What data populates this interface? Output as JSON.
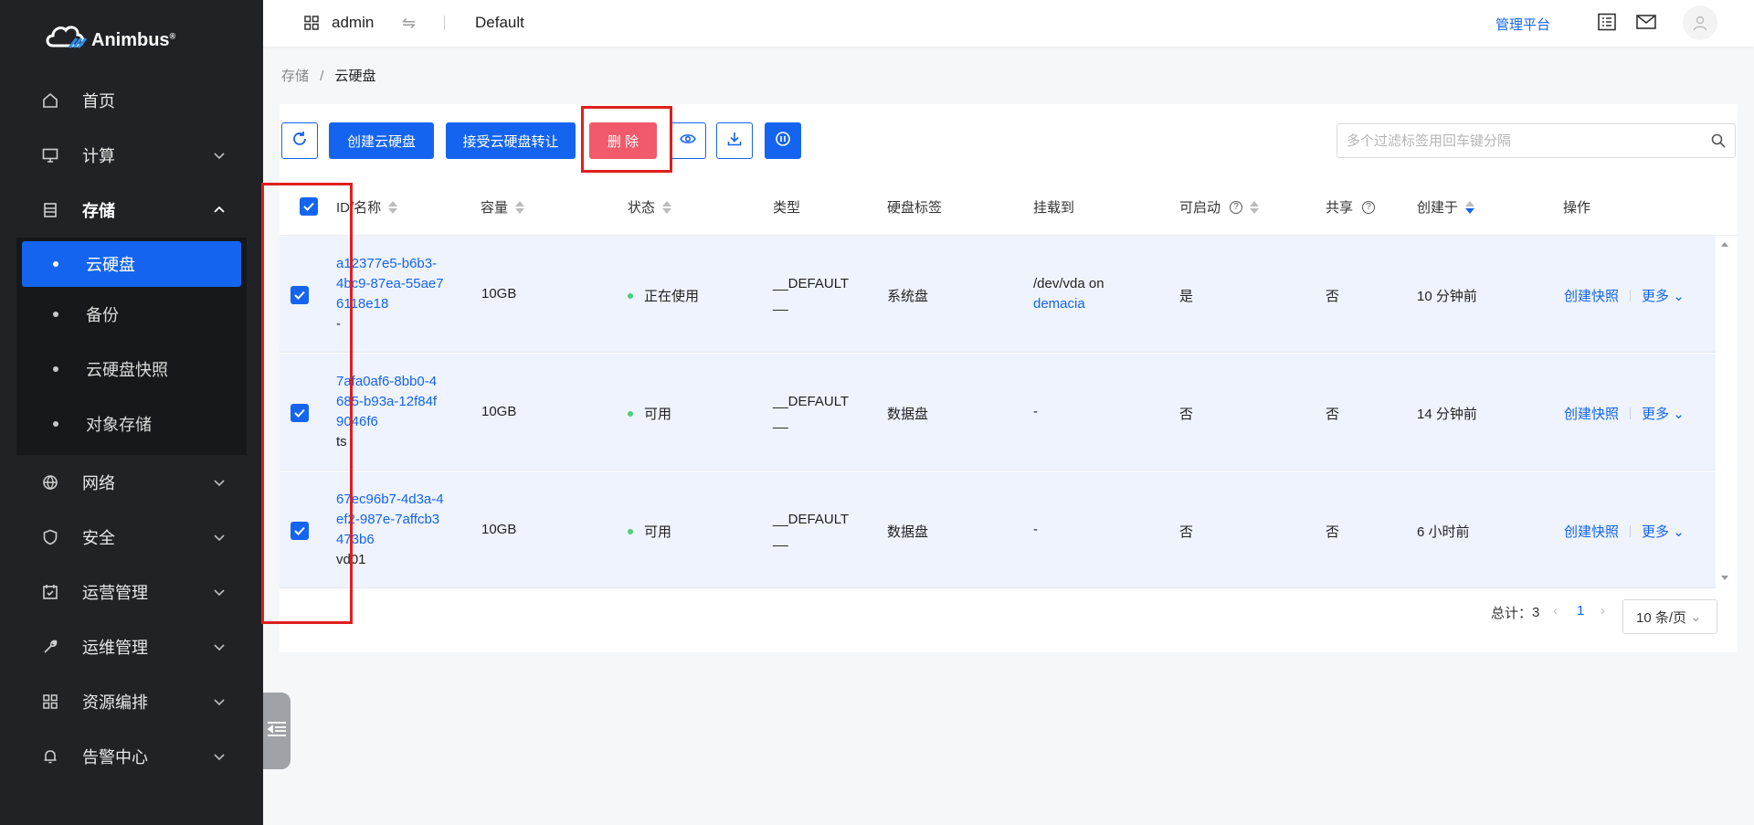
{
  "brand": {
    "name": "Animbus",
    "reg": "®"
  },
  "header": {
    "user": "admin",
    "project": "Default",
    "admin_link": "管理平台"
  },
  "sidebar": {
    "items": [
      {
        "label": "首页",
        "icon": "home-icon"
      },
      {
        "label": "计算",
        "icon": "monitor-icon"
      },
      {
        "label": "存储",
        "icon": "storage-icon"
      },
      {
        "label": "网络",
        "icon": "globe-icon"
      },
      {
        "label": "安全",
        "icon": "shield-icon"
      },
      {
        "label": "运营管理",
        "icon": "calendar-icon"
      },
      {
        "label": "运维管理",
        "icon": "wrench-icon"
      },
      {
        "label": "资源编排",
        "icon": "grid-icon"
      },
      {
        "label": "告警中心",
        "icon": "bell-icon"
      }
    ],
    "storage_sub": [
      {
        "label": "云硬盘"
      },
      {
        "label": "备份"
      },
      {
        "label": "云硬盘快照"
      },
      {
        "label": "对象存储"
      }
    ]
  },
  "breadcrumb": {
    "parent": "存储",
    "sep": "/",
    "current": "云硬盘"
  },
  "toolbar": {
    "create_label": "创建云硬盘",
    "accept_transfer_label": "接受云硬盘转让",
    "delete_label": "删 除",
    "search_placeholder": "多个过滤标签用回车键分隔"
  },
  "table": {
    "headers": {
      "id_name": "ID/名称",
      "size": "容量",
      "status": "状态",
      "type": "类型",
      "tag": "硬盘标签",
      "attached": "挂载到",
      "bootable": "可启动",
      "shared": "共享",
      "created": "创建于",
      "ops": "操作"
    },
    "rows": [
      {
        "id": "a12377e5-b6b3-4bc9-87ea-55ae76118e18",
        "name": "-",
        "size": "10GB",
        "status": "正在使用",
        "type": "__DEFAULT__",
        "tag": "系统盘",
        "attached_prefix": "/dev/vda on",
        "attached_link": "demacia",
        "bootable": "是",
        "shared": "否",
        "created": "10 分钟前",
        "op1": "创建快照",
        "op2": "更多"
      },
      {
        "id": "7afa0af6-8bb0-4685-b93a-12f84f9046f6",
        "name": "ts",
        "size": "10GB",
        "status": "可用",
        "type": "__DEFAULT__",
        "tag": "数据盘",
        "attached_prefix": "-",
        "attached_link": "",
        "bootable": "否",
        "shared": "否",
        "created": "14 分钟前",
        "op1": "创建快照",
        "op2": "更多"
      },
      {
        "id": "67ec96b7-4d3a-4ef2-987e-7affcb3473b6",
        "name": "vd01",
        "size": "10GB",
        "status": "可用",
        "type": "__DEFAULT__",
        "tag": "数据盘",
        "attached_prefix": "-",
        "attached_link": "",
        "bootable": "否",
        "shared": "否",
        "created": "6 小时前",
        "op1": "创建快照",
        "op2": "更多"
      }
    ]
  },
  "pagination": {
    "total_label": "总计：",
    "total": "3",
    "page": "1",
    "page_size": "10 条/页"
  },
  "colors": {
    "primary": "#1464f0",
    "danger": "#f05a6a",
    "sidebar": "#202226",
    "highlight": "#e01e1e"
  }
}
